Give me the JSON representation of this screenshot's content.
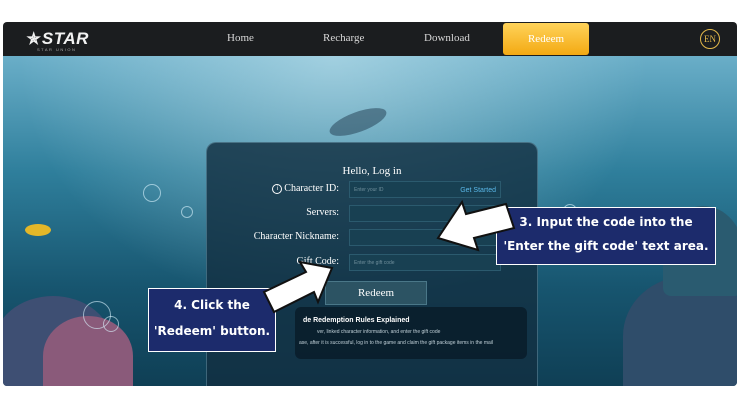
{
  "header": {
    "logo_text": "STAR",
    "logo_subtext": "STAR UNION",
    "nav": [
      "Home",
      "Recharge",
      "Download"
    ],
    "nav_active": "Redeem",
    "language": "EN"
  },
  "panel": {
    "title": "Hello, Log in",
    "character_id_label": "Character ID:",
    "character_id_placeholder": "Enter your ID",
    "get_started": "Get Started",
    "servers_label": "Servers:",
    "nickname_label": "Character Nickname:",
    "gift_code_label": "Gift Code:",
    "gift_code_placeholder": "Enter the gift code",
    "redeem_button": "Redeem",
    "rules_title": "de Redemption Rules Explained",
    "rules_line1": "ver, linked character information, and enter the gift code",
    "rules_line2": "ase, after it is successful, log in to the game and claim the gift package items in the mail"
  },
  "annotations": {
    "step3": "3. Input the code into the 'Enter the gift code' text area.",
    "step3_line1": "3. Input the code into the",
    "step3_line2": "'Enter the gift code' text area.",
    "step4_line1": "4. Click the",
    "step4_line2": "'Redeem' button."
  },
  "colors": {
    "accent": "#f3b21e",
    "callout_bg": "#1c2b6c",
    "panel_bg": "#123042"
  }
}
